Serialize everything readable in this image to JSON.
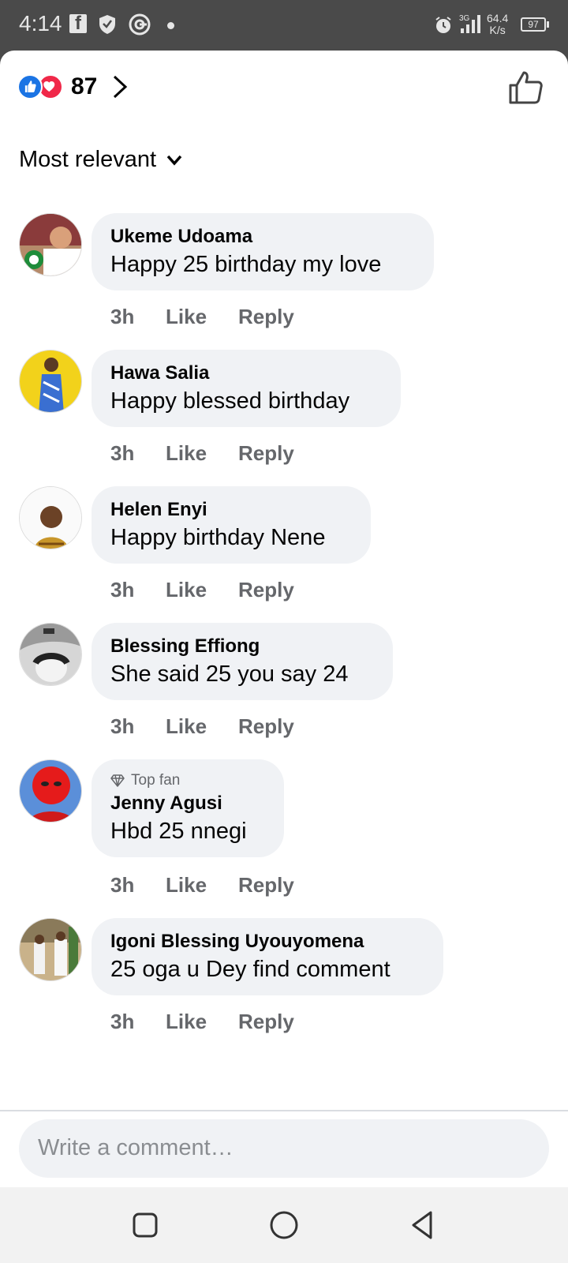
{
  "status_bar": {
    "time": "4:14",
    "network_speed_value": "64.4",
    "network_speed_unit": "K/s",
    "network_type": "3G",
    "battery": "97",
    "icons": [
      "facebook-icon",
      "shield-icon",
      "g-app-icon",
      "dot-icon",
      "alarm-icon",
      "signal-icon",
      "battery-icon"
    ]
  },
  "reactions": {
    "count": "87",
    "types": [
      "like",
      "love"
    ],
    "like_color": "#1b74e4",
    "love_color": "#f02849"
  },
  "sort": {
    "label": "Most relevant"
  },
  "comments": [
    {
      "name": "Ukeme Udoama",
      "text": "Happy 25 birthday my love",
      "time": "3h",
      "like": "Like",
      "reply": "Reply",
      "badge": ""
    },
    {
      "name": "Hawa Salia",
      "text": "Happy blessed birthday",
      "time": "3h",
      "like": "Like",
      "reply": "Reply",
      "badge": ""
    },
    {
      "name": "Helen Enyi",
      "text": "Happy birthday Nene",
      "time": "3h",
      "like": "Like",
      "reply": "Reply",
      "badge": ""
    },
    {
      "name": "Blessing Effiong",
      "text": "She said 25 you say 24",
      "time": "3h",
      "like": "Like",
      "reply": "Reply",
      "badge": ""
    },
    {
      "name": "Jenny Agusi",
      "text": "Hbd 25 nnegi",
      "time": "3h",
      "like": "Like",
      "reply": "Reply",
      "badge": "Top fan"
    },
    {
      "name": "Igoni Blessing Uyouyomena",
      "text": "25 oga u Dey find comment",
      "time": "3h",
      "like": "Like",
      "reply": "Reply",
      "badge": ""
    }
  ],
  "composer": {
    "placeholder": "Write a comment…"
  },
  "navbar": {
    "buttons": [
      "recents-square-icon",
      "home-circle-icon",
      "back-triangle-icon"
    ]
  }
}
